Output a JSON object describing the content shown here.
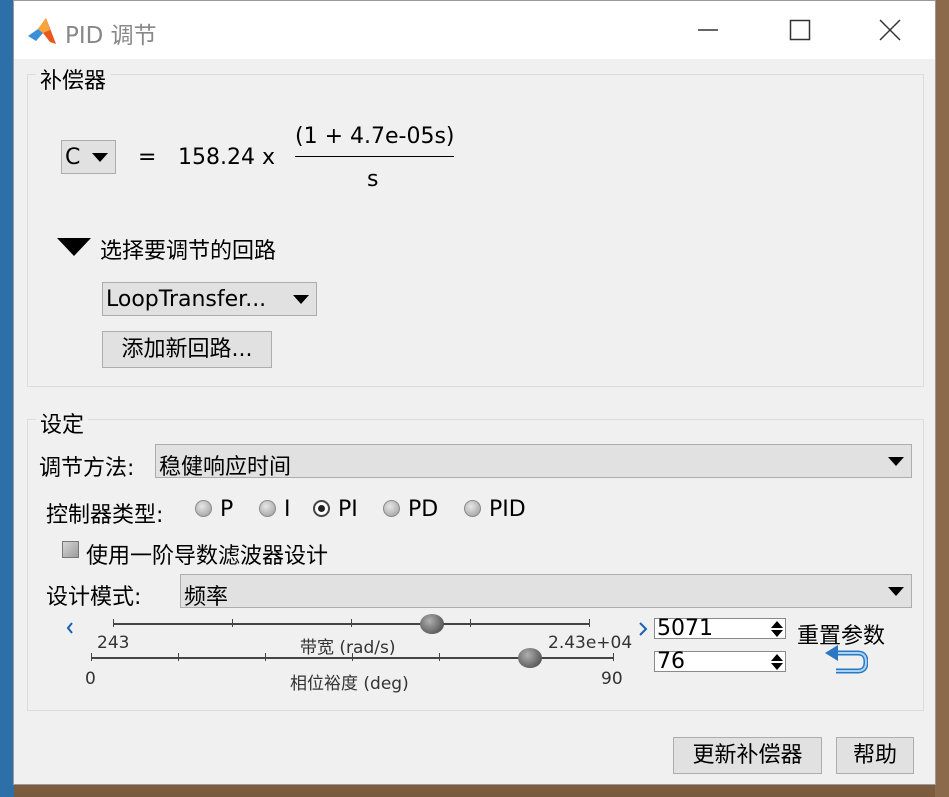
{
  "window": {
    "title": "PID 调节"
  },
  "compensator": {
    "group_label": "补偿器",
    "selector_value": "C",
    "equals": "=",
    "gain_text": "158.24 x",
    "numerator": "(1 + 4.7e-05s)",
    "denominator": "s",
    "loop_section_label": "选择要调节的回路",
    "loop_dropdown_value": "LoopTransfer...",
    "add_loop_label": "添加新回路..."
  },
  "settings": {
    "group_label": "设定",
    "method_label": "调节方法:",
    "method_value": "稳健响应时间",
    "controller_type_label": "控制器类型:",
    "controller_options": [
      "P",
      "I",
      "PI",
      "PD",
      "PID"
    ],
    "controller_selected": "PI",
    "filter_checkbox_label": "使用一阶导数滤波器设计",
    "filter_checked": false,
    "design_mode_label": "设计模式:",
    "design_mode_value": "频率",
    "bandwidth": {
      "label": "带宽 (rad/s)",
      "min_label": "243",
      "max_label": "2.43e+04",
      "value": "5071",
      "slider_fraction": 0.67
    },
    "phase_margin": {
      "label": "相位裕度 (deg)",
      "min_label": "0",
      "max_label": "90",
      "value": "76",
      "slider_fraction": 0.84
    },
    "reset_label": "重置参数"
  },
  "footer": {
    "update_button": "更新补偿器",
    "help_button": "帮助"
  }
}
